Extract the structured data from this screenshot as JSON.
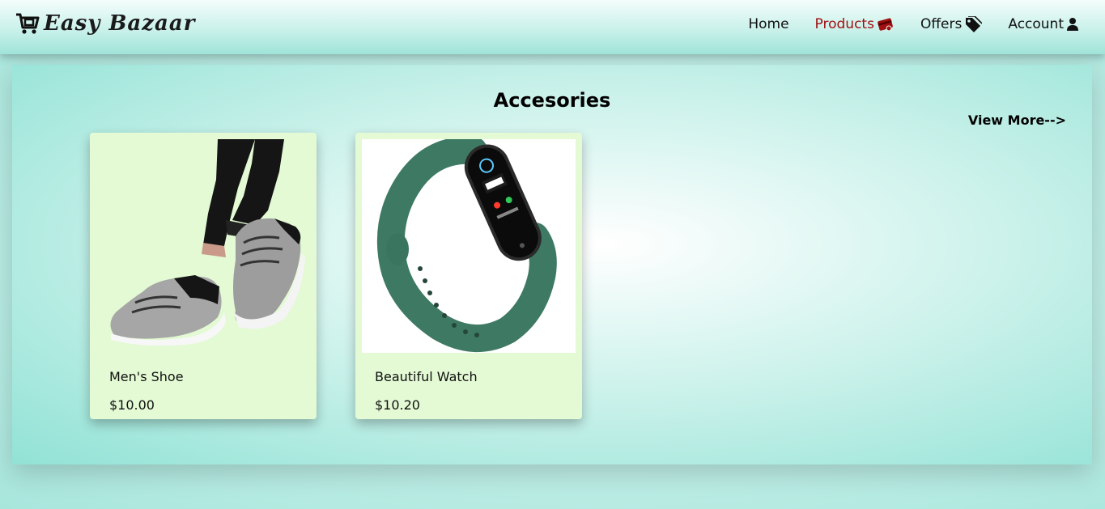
{
  "brand": {
    "name": "Easy Bazaar",
    "icon": "shopping-cart-icon"
  },
  "nav": {
    "items": [
      {
        "label": "Home",
        "icon": ""
      },
      {
        "label": "Products",
        "icon": "credit-card-icon",
        "active": true
      },
      {
        "label": "Offers",
        "icon": "tag-icon"
      },
      {
        "label": "Account",
        "icon": "user-icon"
      }
    ],
    "active_color": "#a01010"
  },
  "section": {
    "title": "Accesories",
    "view_more": "View More-->"
  },
  "products": [
    {
      "name": "Men's Shoe",
      "price": "$10.00",
      "image": "sneakers-image"
    },
    {
      "name": "Beautiful Watch",
      "price": "$10.20",
      "image": "smart-band-image"
    }
  ],
  "colors": {
    "card_bg": "#e3fad4",
    "teal": "#a7e8dd"
  }
}
